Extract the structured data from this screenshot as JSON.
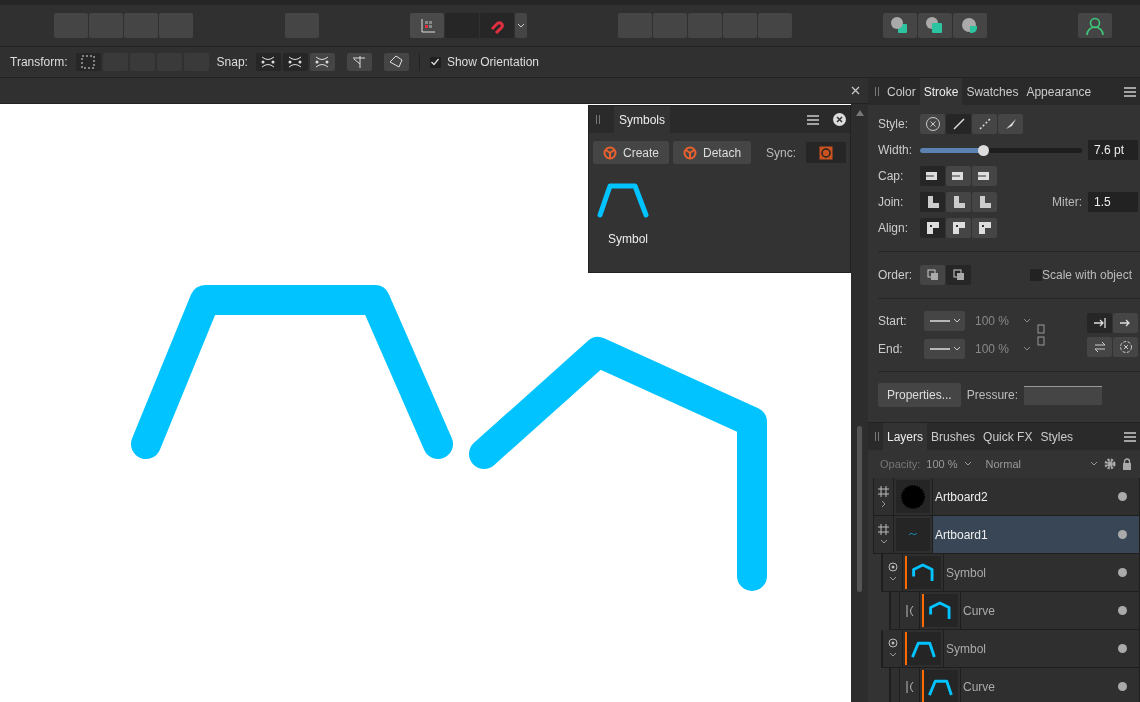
{
  "context_bar": {
    "transform_label": "Transform:",
    "snap_label": "Snap:",
    "snap_modes": [
      {
        "selected": true
      },
      {
        "selected": true
      },
      {
        "selected": false
      }
    ],
    "show_orientation": {
      "label": "Show Orientation",
      "checked": true
    }
  },
  "symbols_panel": {
    "tab": "Symbols",
    "buttons": [
      "Create",
      "Detach"
    ],
    "sync_label": "Sync:",
    "symbols": [
      {
        "label": "Symbol"
      }
    ]
  },
  "stroke_panel": {
    "tabs": [
      {
        "label": "Color",
        "selected": false
      },
      {
        "label": "Stroke",
        "selected": true
      },
      {
        "label": "Swatches",
        "selected": false
      },
      {
        "label": "Appearance",
        "selected": false
      }
    ],
    "style_label": "Style:",
    "styles": [
      {
        "selected": false
      },
      {
        "selected": true
      },
      {
        "selected": false
      },
      {
        "selected": false
      }
    ],
    "width_label": "Width:",
    "width": {
      "level": 0.39,
      "value": "7.6 pt"
    },
    "cap_label": "Cap:",
    "caps": [
      {
        "selected": true
      },
      {
        "selected": false
      },
      {
        "selected": false
      }
    ],
    "join_label": "Join:",
    "joins": [
      {
        "selected": true
      },
      {
        "selected": false
      },
      {
        "selected": false
      }
    ],
    "miter_label": "Miter:",
    "miter": "1.5",
    "align_label": "Align:",
    "aligns": [
      {
        "selected": true
      },
      {
        "selected": false
      },
      {
        "selected": false
      }
    ],
    "order_label": "Order:",
    "orders": [
      {
        "selected": false
      },
      {
        "selected": true
      }
    ],
    "scale_with_object": {
      "label": "Scale with object",
      "checked": false
    },
    "start_label": "Start:",
    "start_scale": "100 %",
    "end_label": "End:",
    "end_scale": "100 %",
    "arrow_positions": [
      {
        "selected": true
      },
      {
        "selected": false
      }
    ],
    "properties_button": "Properties...",
    "pressure_label": "Pressure:"
  },
  "layers_panel": {
    "tabs": [
      {
        "label": "Layers",
        "selected": true
      },
      {
        "label": "Brushes",
        "selected": false
      },
      {
        "label": "Quick FX",
        "selected": false
      },
      {
        "label": "Styles",
        "selected": false
      }
    ],
    "opacity_label": "Opacity:",
    "opacity": "100 %",
    "blend_mode": "Normal",
    "items": [
      {
        "name": "Artboard2",
        "kind": "artboard",
        "selected": false,
        "expanded": false
      },
      {
        "name": "Artboard1",
        "kind": "artboard",
        "selected": true,
        "expanded": true,
        "children": [
          {
            "name": "Symbol",
            "kind": "symbol",
            "selected": false,
            "expanded": true,
            "children": [
              {
                "name": "Curve",
                "kind": "curve",
                "selected": false
              }
            ]
          },
          {
            "name": "Symbol",
            "kind": "symbol",
            "selected": false,
            "expanded": true,
            "children": [
              {
                "name": "Curve",
                "kind": "curve",
                "selected": false
              }
            ]
          }
        ]
      }
    ]
  }
}
